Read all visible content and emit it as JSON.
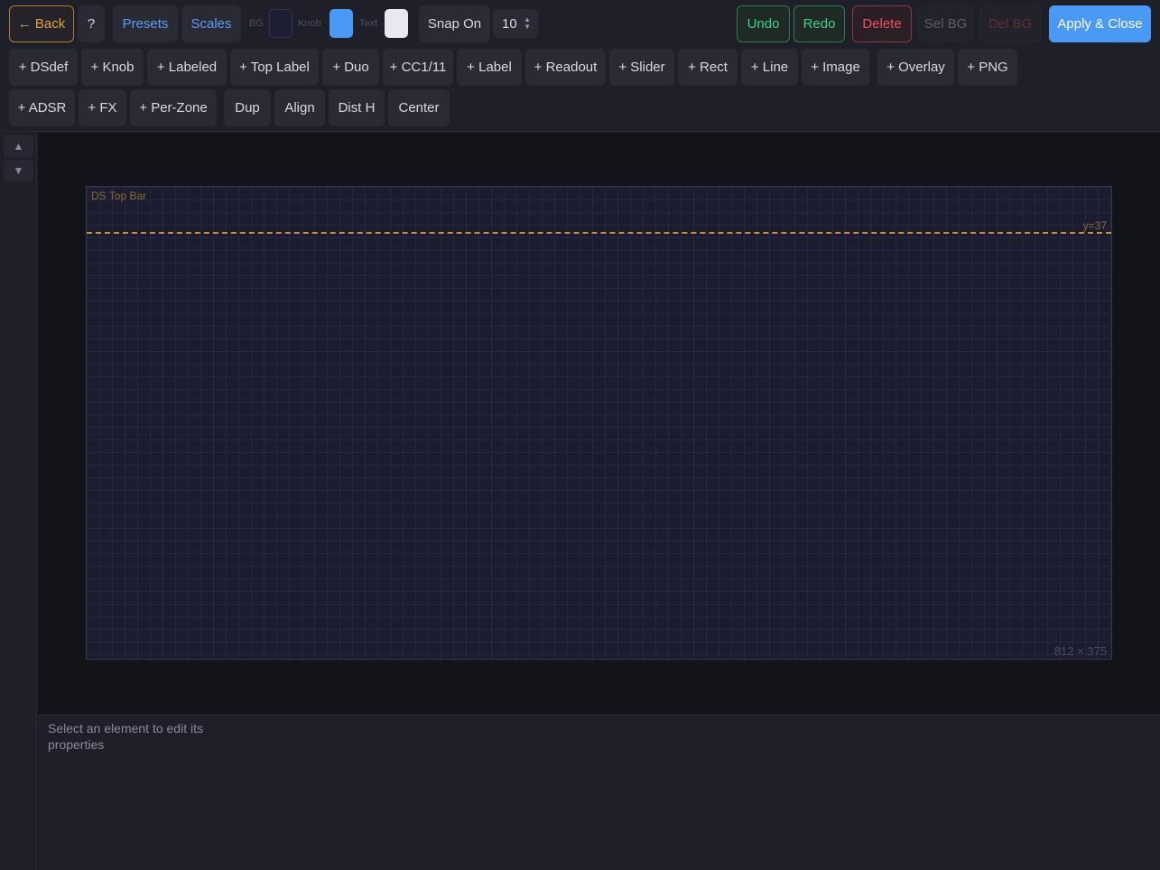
{
  "toolbar": {
    "back_label": "← Back",
    "help_label": "?",
    "presets_label": "Presets",
    "scales_label": "Scales",
    "bg_label": "BG",
    "knob_label": "Knob",
    "text_label": "Text",
    "snap_label": "Snap On",
    "snap_value": "10",
    "undo_label": "Undo",
    "redo_label": "Redo",
    "delete_label": "Delete",
    "sel_bg_label": "Sel BG",
    "del_bg_label": "Del BG",
    "apply_label": "Apply & Close",
    "colors": {
      "bg_swatch": "#1d1d33",
      "knob_swatch": "#4a9af5",
      "text_swatch": "#e8e8f0"
    }
  },
  "add_row_1": [
    "+ DSdef",
    "+ Knob",
    "+ Labeled",
    "+ Top Label",
    "+ Duo",
    "+ CC1/11",
    "+ Label",
    "+ Readout",
    "+ Slider",
    "+ Rect",
    "+ Line",
    "+ Image",
    "+ Overlay",
    "+ PNG"
  ],
  "add_row_2": [
    "+ ADSR",
    "+ FX",
    "+ Per-Zone",
    "Dup",
    "Align",
    "Dist H",
    "Center"
  ],
  "side": {
    "up_icon": "▲",
    "down_icon": "▼"
  },
  "canvas": {
    "board_name": "DS Top Bar",
    "guide_label": "y=37",
    "dimensions": "812 × 375"
  },
  "properties": {
    "empty_message": "Select an element to edit its properties"
  }
}
